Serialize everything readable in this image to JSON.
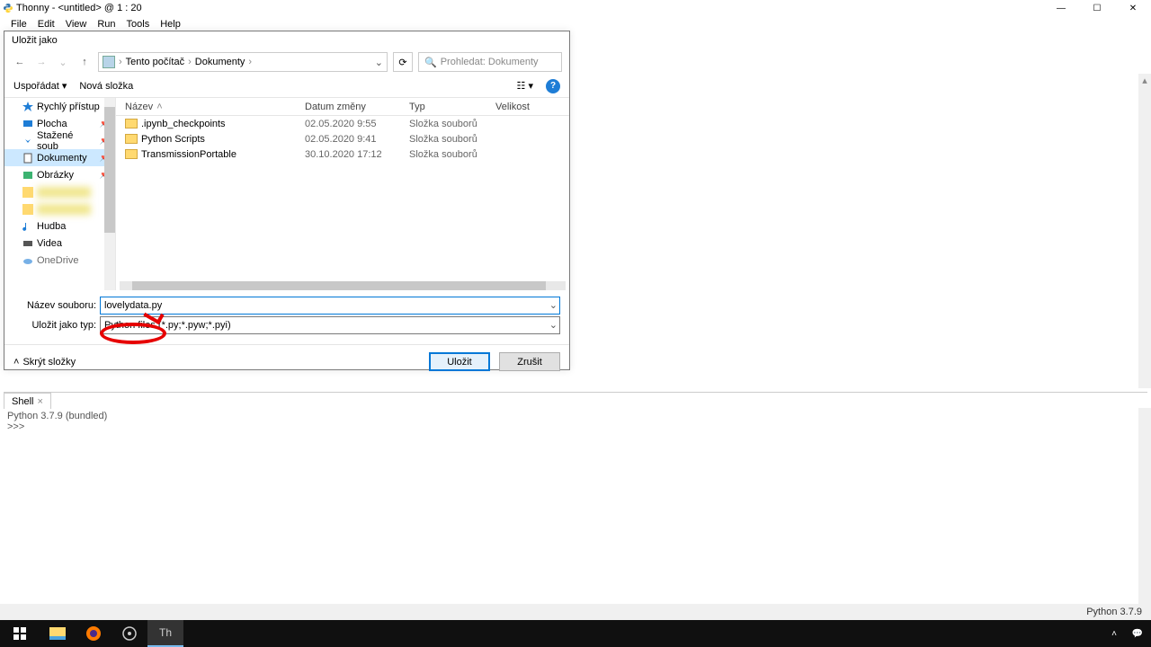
{
  "titlebar": {
    "title": "Thonny  -  <untitled>  @  1 : 20"
  },
  "menu": {
    "file": "File",
    "edit": "Edit",
    "view": "View",
    "run": "Run",
    "tools": "Tools",
    "help": "Help"
  },
  "dialog": {
    "title": "Uložit jako",
    "breadcrumb": {
      "root": "Tento počítač",
      "folder": "Dokumenty"
    },
    "search_placeholder": "Prohledat: Dokumenty",
    "organize": "Uspořádat",
    "newfolder": "Nová složka",
    "nav": {
      "quick": "Rychlý přístup",
      "desktop": "Plocha",
      "downloads": "Stažené soub",
      "documents": "Dokumenty",
      "pictures": "Obrázky",
      "music": "Hudba",
      "videos": "Videa",
      "onedrive": "OneDrive"
    },
    "cols": {
      "name": "Název",
      "date": "Datum změny",
      "type": "Typ",
      "size": "Velikost"
    },
    "rows": [
      {
        "name": ".ipynb_checkpoints",
        "date": "02.05.2020 9:55",
        "type": "Složka souborů"
      },
      {
        "name": "Python Scripts",
        "date": "02.05.2020 9:41",
        "type": "Složka souborů"
      },
      {
        "name": "TransmissionPortable",
        "date": "30.10.2020 17:12",
        "type": "Složka souborů"
      }
    ],
    "filename_label": "Název souboru:",
    "filename_value": "lovelydata.py",
    "saveas_label": "Uložit jako typ:",
    "saveas_value": "Python files (*.py;*.pyw;*.pyi)",
    "hide_folders": "Skrýt složky",
    "save": "Uložit",
    "cancel": "Zrušit"
  },
  "shell": {
    "tab": "Shell",
    "line1": "Python 3.7.9 (bundled)",
    "prompt": ">>>"
  },
  "status": "Python 3.7.9"
}
